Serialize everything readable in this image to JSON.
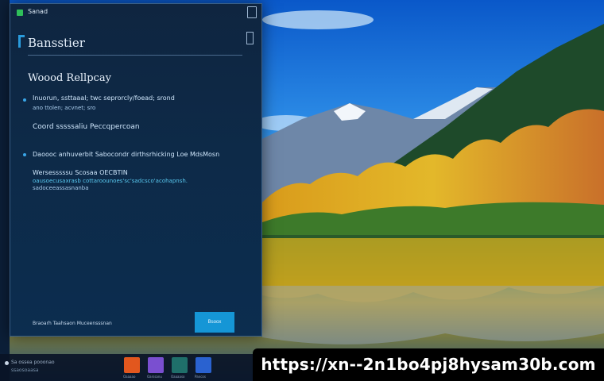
{
  "dialog": {
    "app_title": "Sanad",
    "header_title": "Bansstier",
    "section_title": "Woood Rellpcay",
    "items": [
      {
        "line1": "Inuorun, ssttaaal; twc seprorcly/foead; srond",
        "line2": "ano ttolen; acvnet; sro"
      },
      {
        "line1": "Coord sssssaliu Peccqpercoan"
      },
      {
        "line1": "Daoooc anhuverbit Sabocondr dirthsrhicking Loe MdsMosn"
      },
      {
        "line1": "Wersesssssu Scosaa OECBTIN",
        "line2": "oausoecusaxrasb cottaroounoes'sc'sadcsco'acohapnsh.",
        "line3": "sadoceeassasnanba"
      }
    ],
    "footer_text": "Braoarh Taahsaon Muceensssnan",
    "primary_button": "Bsoox"
  },
  "taskbar": {
    "search_text": "Sa ossea pooonao",
    "search_sub": "ssaosoaasa",
    "apps": [
      {
        "name": "office",
        "label": "Oaaaao",
        "color": "#e2571e"
      },
      {
        "name": "onenote",
        "label": "Oarssanu",
        "color": "#7a4fd0"
      },
      {
        "name": "calendar",
        "label": "Oaaaaso",
        "color": "#1f6f6a"
      },
      {
        "name": "photos",
        "label": "Pancos",
        "color": "#2a62d0"
      }
    ]
  },
  "url_banner": "https://xn--2n1bo4pj8hysam30b.com",
  "colors": {
    "accent": "#1596d6",
    "bullet": "#3aa6e8",
    "dialog_bg": "#0d2a48"
  }
}
